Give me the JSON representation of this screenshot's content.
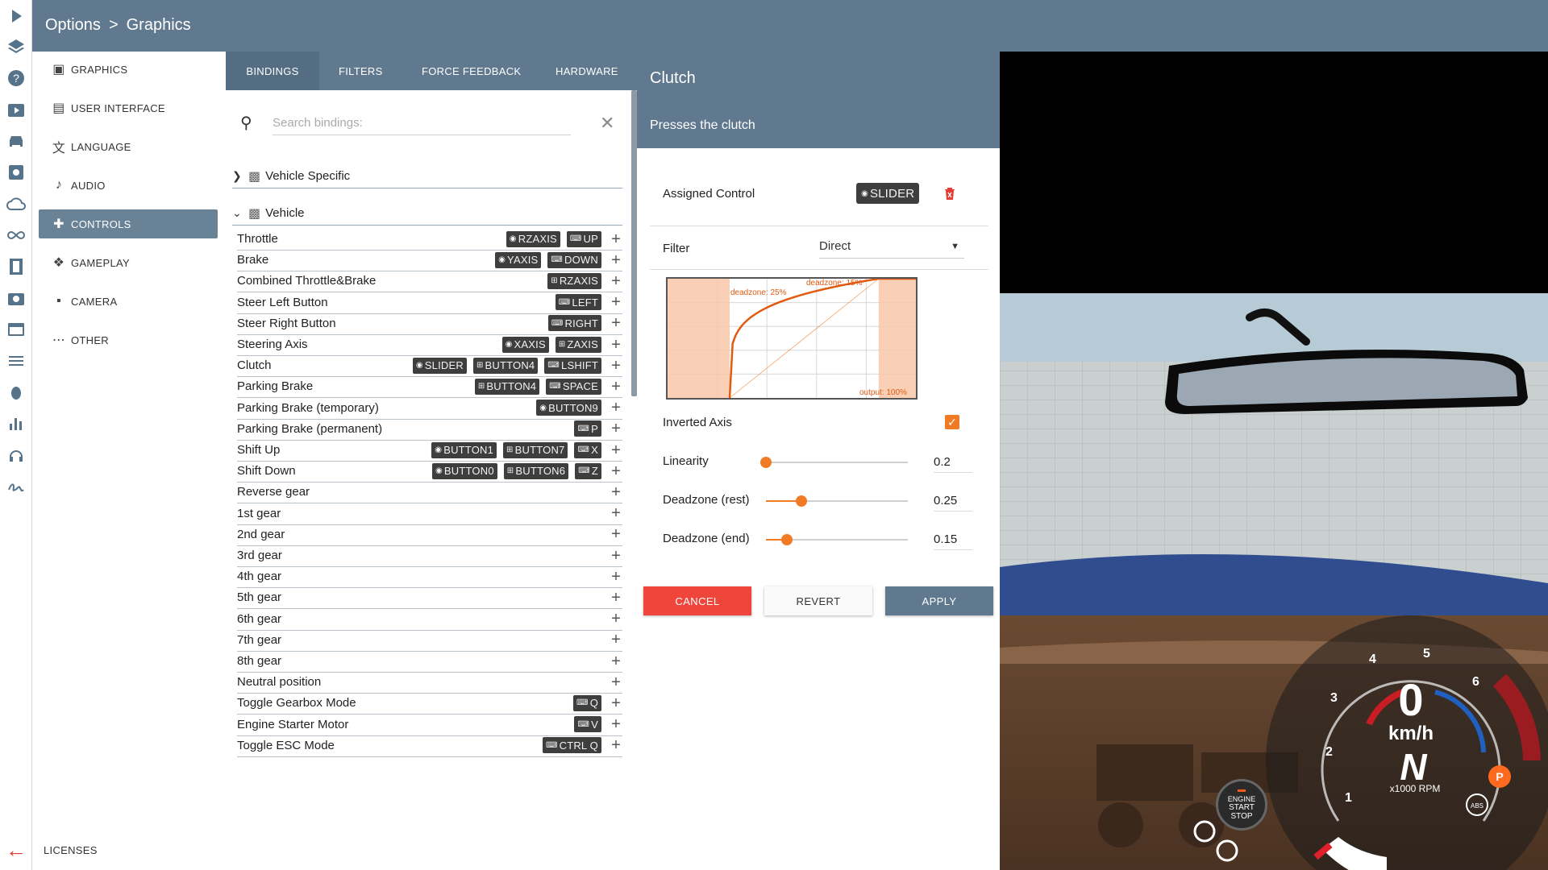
{
  "header": {
    "breadcrumb_root": "Options",
    "breadcrumb_sep": ">",
    "breadcrumb_current": "Graphics"
  },
  "categories": [
    {
      "label": "GRAPHICS",
      "icon": "monitor-icon"
    },
    {
      "label": "USER INTERFACE",
      "icon": "window-icon"
    },
    {
      "label": "LANGUAGE",
      "icon": "translate-icon"
    },
    {
      "label": "AUDIO",
      "icon": "speaker-icon"
    },
    {
      "label": "CONTROLS",
      "icon": "gamepad-icon"
    },
    {
      "label": "GAMEPLAY",
      "icon": "puzzle-icon"
    },
    {
      "label": "CAMERA",
      "icon": "video-camera-icon"
    },
    {
      "label": "OTHER",
      "icon": "more-icon"
    }
  ],
  "active_category": "CONTROLS",
  "licenses_label": "LICENSES",
  "tabs": [
    "BINDINGS",
    "FILTERS",
    "FORCE FEEDBACK",
    "HARDWARE"
  ],
  "active_tab": "BINDINGS",
  "search": {
    "placeholder": "Search bindings:",
    "value": ""
  },
  "groups": [
    {
      "label": "Vehicle Specific",
      "expanded": false
    },
    {
      "label": "Vehicle",
      "expanded": true
    }
  ],
  "bindings": [
    {
      "name": "Throttle",
      "controls": [
        {
          "type": "axis",
          "label": "RZAXIS"
        },
        {
          "type": "key",
          "label": "UP"
        }
      ]
    },
    {
      "name": "Brake",
      "controls": [
        {
          "type": "axis",
          "label": "YAXIS"
        },
        {
          "type": "key",
          "label": "DOWN"
        }
      ]
    },
    {
      "name": "Combined Throttle&Brake",
      "controls": [
        {
          "type": "pad",
          "label": "RZAXIS"
        }
      ]
    },
    {
      "name": "Steer Left Button",
      "controls": [
        {
          "type": "key",
          "label": "LEFT"
        }
      ]
    },
    {
      "name": "Steer Right Button",
      "controls": [
        {
          "type": "key",
          "label": "RIGHT"
        }
      ]
    },
    {
      "name": "Steering Axis",
      "controls": [
        {
          "type": "axis",
          "label": "XAXIS"
        },
        {
          "type": "pad",
          "label": "ZAXIS"
        }
      ]
    },
    {
      "name": "Clutch",
      "controls": [
        {
          "type": "axis",
          "label": "SLIDER"
        },
        {
          "type": "pad",
          "label": "BUTTON4"
        },
        {
          "type": "key",
          "label": "LSHIFT"
        }
      ]
    },
    {
      "name": "Parking Brake",
      "controls": [
        {
          "type": "pad",
          "label": "BUTTON4"
        },
        {
          "type": "key",
          "label": "SPACE"
        }
      ]
    },
    {
      "name": "Parking Brake (temporary)",
      "controls": [
        {
          "type": "axis",
          "label": "BUTTON9"
        }
      ]
    },
    {
      "name": "Parking Brake (permanent)",
      "controls": [
        {
          "type": "key",
          "label": "P"
        }
      ]
    },
    {
      "name": "Shift Up",
      "controls": [
        {
          "type": "axis",
          "label": "BUTTON1"
        },
        {
          "type": "pad",
          "label": "BUTTON7"
        },
        {
          "type": "key",
          "label": "X"
        }
      ]
    },
    {
      "name": "Shift Down",
      "controls": [
        {
          "type": "axis",
          "label": "BUTTON0"
        },
        {
          "type": "pad",
          "label": "BUTTON6"
        },
        {
          "type": "key",
          "label": "Z"
        }
      ]
    },
    {
      "name": "Reverse gear",
      "controls": []
    },
    {
      "name": "1st gear",
      "controls": []
    },
    {
      "name": "2nd gear",
      "controls": []
    },
    {
      "name": "3rd gear",
      "controls": []
    },
    {
      "name": "4th gear",
      "controls": []
    },
    {
      "name": "5th gear",
      "controls": []
    },
    {
      "name": "6th gear",
      "controls": []
    },
    {
      "name": "7th gear",
      "controls": []
    },
    {
      "name": "8th gear",
      "controls": []
    },
    {
      "name": "Neutral position",
      "controls": []
    },
    {
      "name": "Toggle Gearbox Mode",
      "controls": [
        {
          "type": "key",
          "label": "Q"
        }
      ]
    },
    {
      "name": "Engine Starter Motor",
      "controls": [
        {
          "type": "key",
          "label": "V"
        }
      ]
    },
    {
      "name": "Toggle ESC Mode",
      "controls": [
        {
          "type": "key",
          "label": "CTRL Q"
        }
      ]
    }
  ],
  "detail": {
    "title": "Clutch",
    "description": "Presses the clutch",
    "assigned_label": "Assigned Control",
    "assigned_control": "SLIDER",
    "filter_label": "Filter",
    "filter_value": "Direct",
    "curve": {
      "label_deadzone_rest": "deadzone: 25%",
      "label_deadzone_end": "deadzone: 15%",
      "label_output": "output: 100%",
      "deadzone_rest": 0.25,
      "deadzone_end": 0.15,
      "linearity": 0.2
    },
    "inverted_label": "Inverted Axis",
    "inverted": true,
    "sliders": [
      {
        "label": "Linearity",
        "value": "0.2",
        "fraction": 0.0
      },
      {
        "label": "Deadzone (rest)",
        "value": "0.25",
        "fraction": 0.25
      },
      {
        "label": "Deadzone (end)",
        "value": "0.15",
        "fraction": 0.15
      }
    ],
    "buttons": {
      "cancel": "CANCEL",
      "revert": "REVERT",
      "apply": "APPLY"
    }
  },
  "hud": {
    "speed": "0",
    "unit": "km/h",
    "gear": "N",
    "rpm_label": "x1000 RPM",
    "rpm_marks": [
      "1",
      "2",
      "3",
      "4",
      "5",
      "6"
    ],
    "engine_button": [
      "ENGINE",
      "START",
      "STOP"
    ],
    "parking": "P",
    "abs": "ABS"
  },
  "colors": {
    "accent": "#f07b24",
    "header": "#60798f",
    "danger": "#f0453a",
    "chip": "#3e3e3e"
  }
}
